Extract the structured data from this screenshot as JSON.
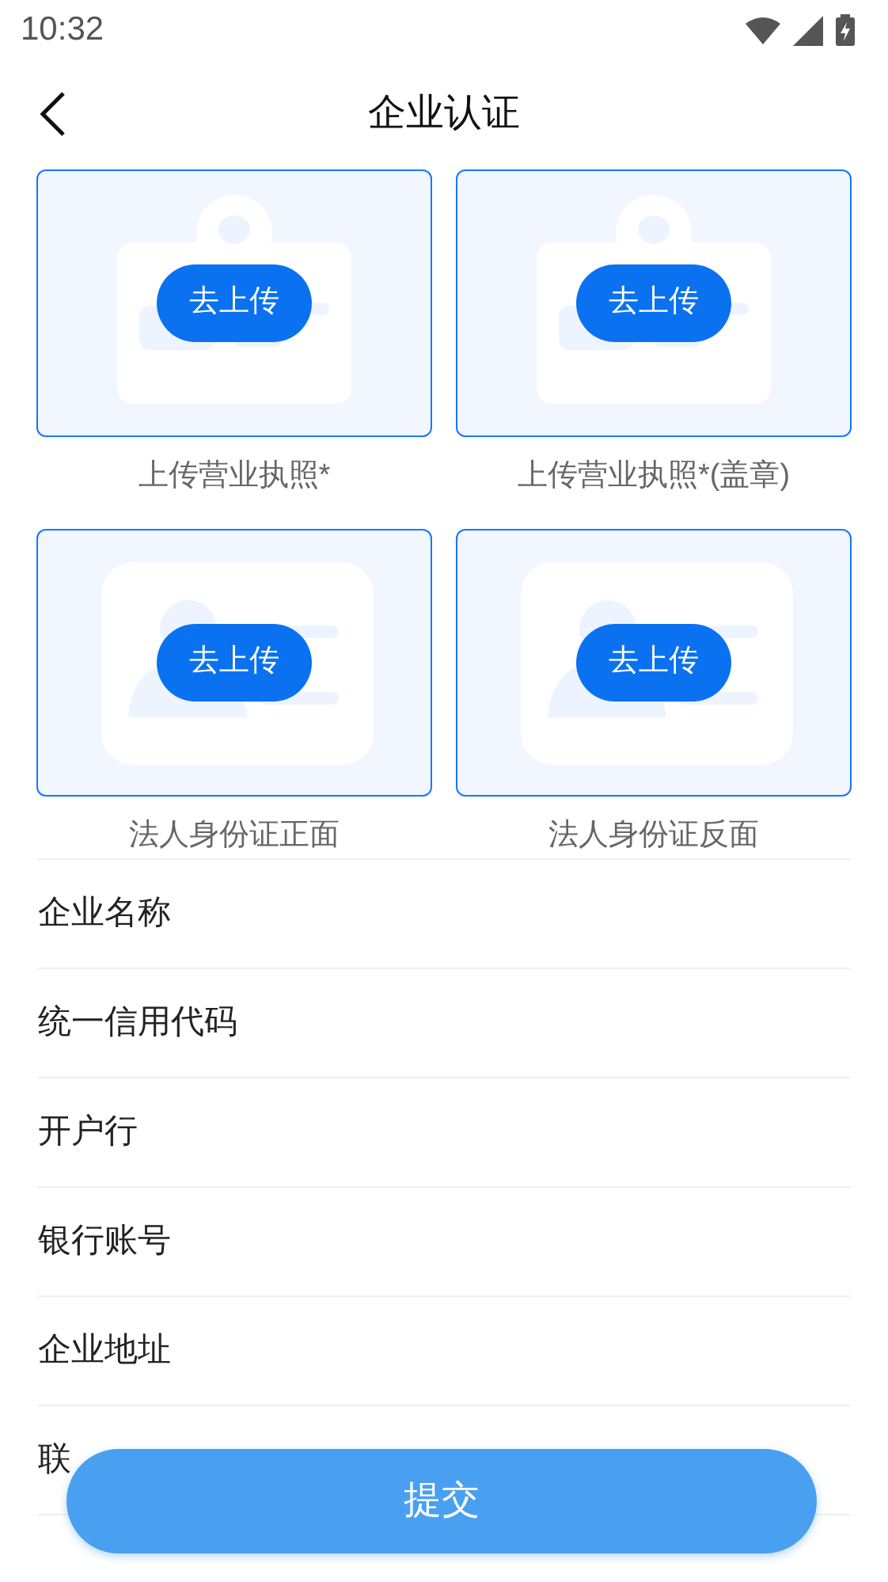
{
  "status_bar": {
    "time": "10:32"
  },
  "header": {
    "title": "企业认证"
  },
  "uploads": [
    {
      "kind": "license",
      "button": "去上传",
      "caption": "上传营业执照*"
    },
    {
      "kind": "license",
      "button": "去上传",
      "caption": "上传营业执照*(盖章)"
    },
    {
      "kind": "id_card",
      "button": "去上传",
      "caption": "法人身份证正面"
    },
    {
      "kind": "id_card",
      "button": "去上传",
      "caption": "法人身份证反面"
    }
  ],
  "form_fields": [
    {
      "label": "企业名称"
    },
    {
      "label": "统一信用代码"
    },
    {
      "label": "开户行"
    },
    {
      "label": "银行账号"
    },
    {
      "label": "企业地址"
    },
    {
      "label": "联"
    }
  ],
  "submit_button": "提交"
}
